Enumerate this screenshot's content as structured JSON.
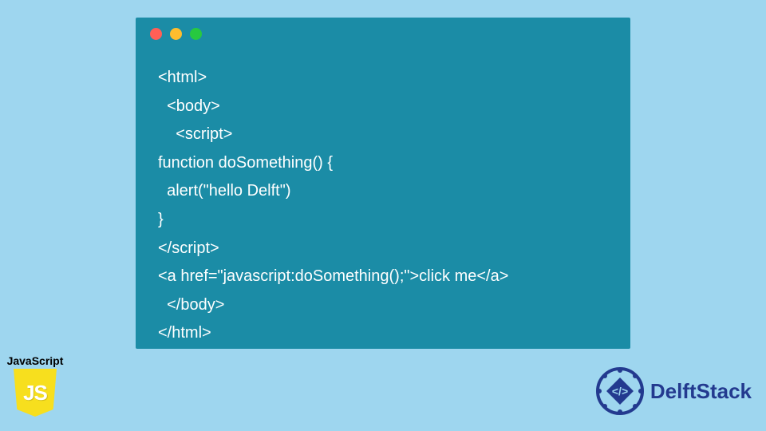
{
  "code": {
    "lines": [
      "<html>",
      "  <body>",
      "    <script>",
      "function doSomething() {",
      "  alert(\"hello Delft\")",
      "}",
      "</script>",
      "<a href=\"javascript:doSomething();\">click me</a>",
      "  </body>",
      "</html>"
    ]
  },
  "jsBadge": {
    "label": "JavaScript",
    "shieldText": "JS"
  },
  "brand": {
    "name": "DelftStack"
  },
  "windowDots": [
    "red",
    "yellow",
    "green"
  ]
}
